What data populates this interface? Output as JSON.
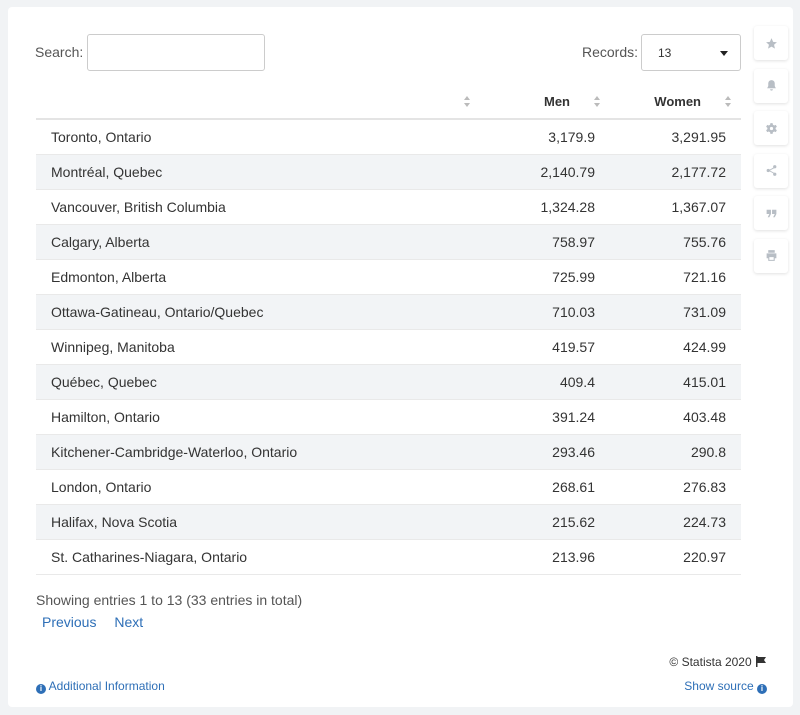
{
  "search": {
    "label": "Search:",
    "value": ""
  },
  "records": {
    "label": "Records:",
    "selected": "13"
  },
  "table": {
    "headers": [
      "",
      "Men",
      "Women"
    ],
    "rows": [
      [
        "Toronto, Ontario",
        "3,179.9",
        "3,291.95"
      ],
      [
        "Montréal, Quebec",
        "2,140.79",
        "2,177.72"
      ],
      [
        "Vancouver, British Columbia",
        "1,324.28",
        "1,367.07"
      ],
      [
        "Calgary, Alberta",
        "758.97",
        "755.76"
      ],
      [
        "Edmonton, Alberta",
        "725.99",
        "721.16"
      ],
      [
        "Ottawa-Gatineau, Ontario/Quebec",
        "710.03",
        "731.09"
      ],
      [
        "Winnipeg, Manitoba",
        "419.57",
        "424.99"
      ],
      [
        "Québec, Quebec",
        "409.4",
        "415.01"
      ],
      [
        "Hamilton, Ontario",
        "391.24",
        "403.48"
      ],
      [
        "Kitchener-Cambridge-Waterloo, Ontario",
        "293.46",
        "290.8"
      ],
      [
        "London, Ontario",
        "268.61",
        "276.83"
      ],
      [
        "Halifax, Nova Scotia",
        "215.62",
        "224.73"
      ],
      [
        "St. Catharines-Niagara, Ontario",
        "213.96",
        "220.97"
      ]
    ]
  },
  "footer": {
    "showing": "Showing entries 1 to 13 (33 entries in total)",
    "previous": "Previous",
    "next": "Next",
    "copyright": "© Statista 2020",
    "additional_info": "Additional Information",
    "show_source": "Show source"
  },
  "sidebar_icons": [
    "star-icon",
    "bell-icon",
    "gear-icon",
    "share-icon",
    "quote-icon",
    "print-icon"
  ],
  "colors": {
    "link": "#2e6fb7",
    "stripe": "#f2f4f6",
    "icon": "#b8bec5"
  }
}
